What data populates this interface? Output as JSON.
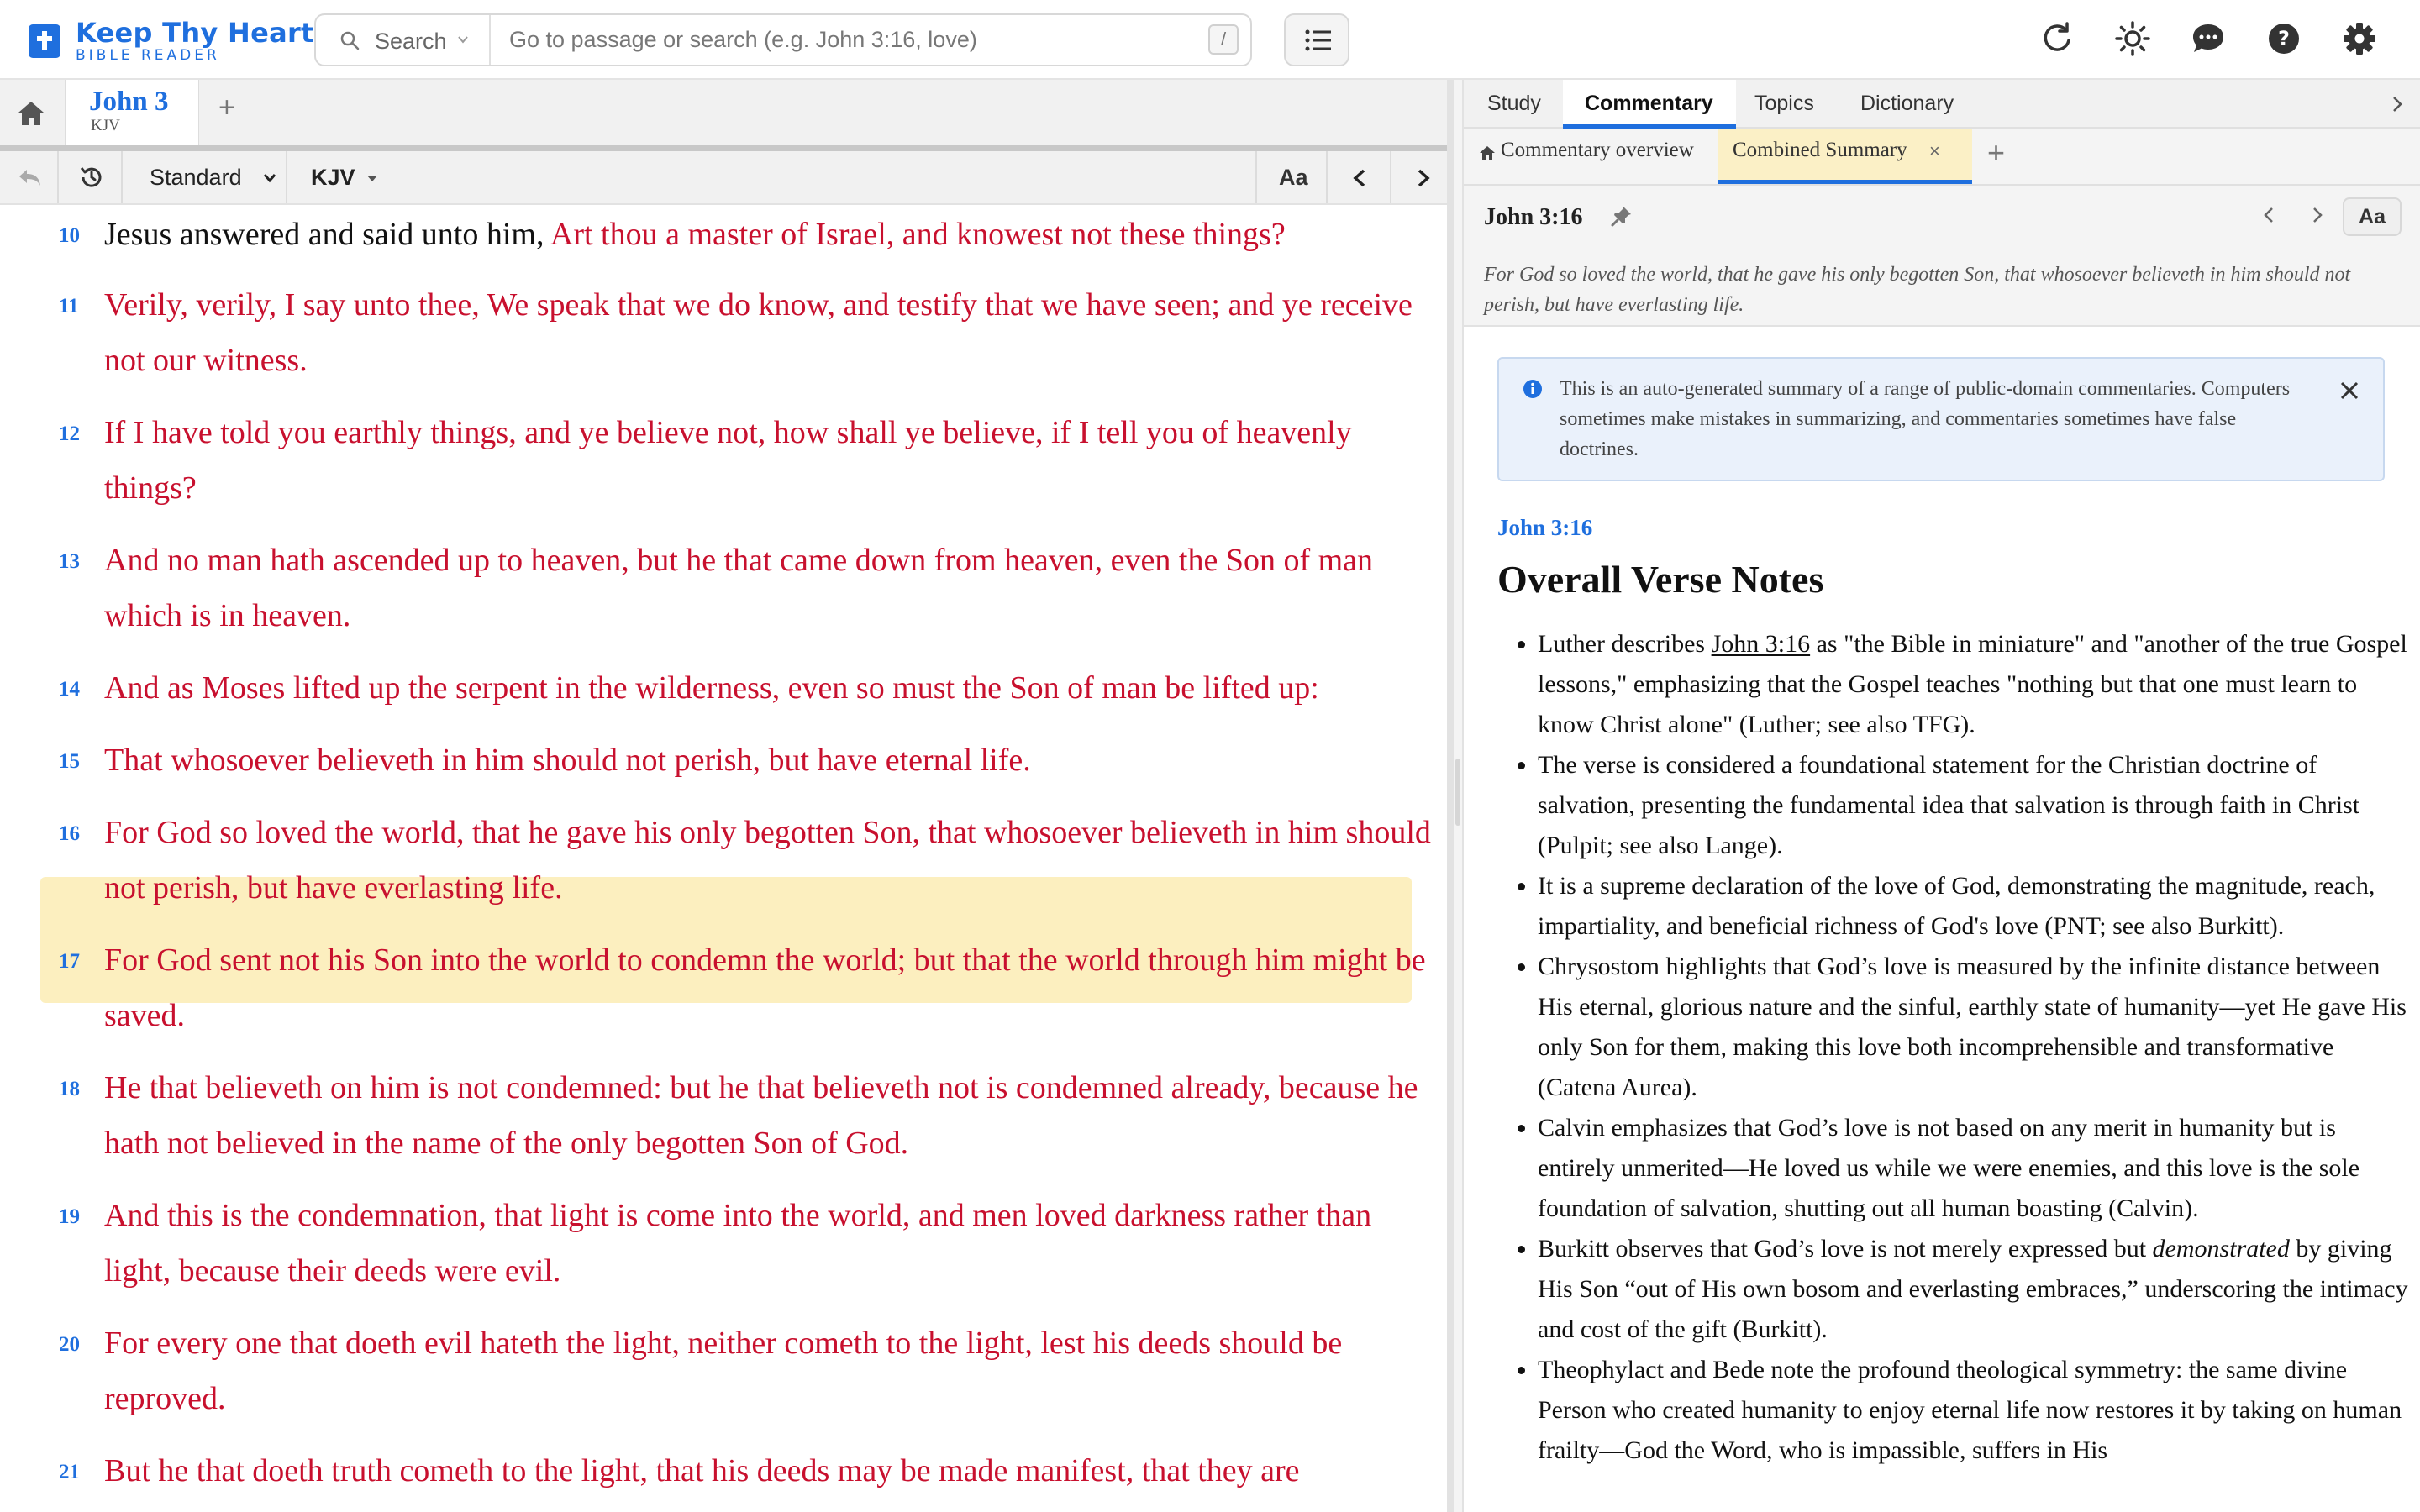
{
  "app": {
    "title": "Keep Thy Heart",
    "subtitle": "BIBLE READER",
    "brand_color": "#1f6fde"
  },
  "search": {
    "mode_label": "Search",
    "placeholder": "Go to passage or search (e.g. John 3:16, love)",
    "shortcut_key": "/"
  },
  "header_icons": [
    "refresh-icon",
    "theme-icon",
    "chat-icon",
    "help-icon",
    "settings-icon"
  ],
  "left": {
    "tab": {
      "title": "John 3",
      "subtitle": "KJV"
    },
    "add_tab_label": "+",
    "toolbar": {
      "layout_select": "Standard",
      "version_select": "KJV",
      "font_button": "Aa"
    },
    "verses": [
      {
        "num": "10",
        "prefix": "Jesus answered and said unto him, ",
        "text": "Art thou a master of Israel, and knowest not these things?"
      },
      {
        "num": "11",
        "prefix": "",
        "text": "Verily, verily, I say unto thee, We speak that we do know, and testify that we have seen; and ye receive not our witness."
      },
      {
        "num": "12",
        "prefix": "",
        "text": "If I have told you earthly things, and ye believe not, how shall ye believe, if I tell you of heavenly things?"
      },
      {
        "num": "13",
        "prefix": "",
        "text": "And no man hath ascended up to heaven, but he that came down from heaven, even the Son of man which is in heaven."
      },
      {
        "num": "14",
        "prefix": "",
        "text": "And as Moses lifted up the serpent in the wilderness, even so must the Son of man be lifted up:"
      },
      {
        "num": "15",
        "prefix": "",
        "text": "That whosoever believeth in him should not perish, but have eternal life."
      },
      {
        "num": "16",
        "prefix": "",
        "text": "For God so loved the world, that he gave his only begotten Son, that whosoever believeth in him should not perish, but have everlasting life.",
        "highlighted": true
      },
      {
        "num": "17",
        "prefix": "",
        "text": "For God sent not his Son into the world to condemn the world; but that the world through him might be saved."
      },
      {
        "num": "18",
        "prefix": "",
        "text": "He that believeth on him is not condemned: but he that believeth not is condemned already, because he hath not believed in the name of the only begotten Son of God."
      },
      {
        "num": "19",
        "prefix": "",
        "text": "And this is the condemnation, that light is come into the world, and men loved darkness rather than light, because their deeds were evil."
      },
      {
        "num": "20",
        "prefix": "",
        "text": "For every one that doeth evil hateth the light, neither cometh to the light, lest his deeds should be reproved."
      },
      {
        "num": "21",
        "prefix": "",
        "text": "But he that doeth truth cometh to the light, that his deeds may be made manifest, that they are"
      }
    ],
    "highlight_color": "#fcefbf",
    "words_of_christ_color": "#c8102e"
  },
  "right": {
    "tabs": [
      "Study",
      "Commentary",
      "Topics",
      "Dictionary"
    ],
    "active_tab": "Commentary",
    "subtabs": {
      "overview": "Commentary overview",
      "active": "Combined Summary",
      "close": "×",
      "add": "+"
    },
    "reference": "John 3:16",
    "font_button": "Aa",
    "verse_text": "For God so loved the world, that he gave his only begotten Son, that whosoever believeth in him should not perish, but have everlasting life.",
    "notice": "This is an auto-generated summary of a range of public-domain commentaries. Computers sometimes make mistakes in summarizing, and commentaries sometimes have false doctrines.",
    "content_ref": "John 3:16",
    "heading": "Overall Verse Notes",
    "notes": {
      "n1_a": "Luther describes ",
      "n1_link": "John 3:16",
      "n1_b": " as \"the Bible in miniature\" and \"another of the true Gospel lessons,\" emphasizing that the Gospel teaches \"nothing but that one must learn to know Christ alone\" (Luther; see also TFG).",
      "n2": "The verse is considered a foundational statement for the Christian doctrine of salvation, presenting the fundamental idea that salvation is through faith in Christ (Pulpit; see also Lange).",
      "n3": "It is a supreme declaration of the love of God, demonstrating the magnitude, reach, impartiality, and beneficial richness of God's love (PNT; see also Burkitt).",
      "n4": "Chrysostom highlights that God’s love is measured by the infinite distance between His eternal, glorious nature and the sinful, earthly state of humanity—yet He gave His only Son for them, making this love both incomprehensible and transformative (Catena Aurea).",
      "n5": "Calvin emphasizes that God’s love is not based on any merit in humanity but is entirely unmerited—He loved us while we were enemies, and this love is the sole foundation of salvation, shutting out all human boasting (Calvin).",
      "n6_a": "Burkitt observes that God’s love is not merely expressed but ",
      "n6_em": "demonstrated",
      "n6_b": " by giving His Son “out of His own bosom and everlasting embraces,” underscoring the intimacy and cost of the gift (Burkitt).",
      "n7": "Theophylact and Bede note the profound theological symmetry: the same divine Person who created humanity to enjoy eternal life now restores it by taking on human frailty—God the Word, who is impassible, suffers in His"
    }
  }
}
